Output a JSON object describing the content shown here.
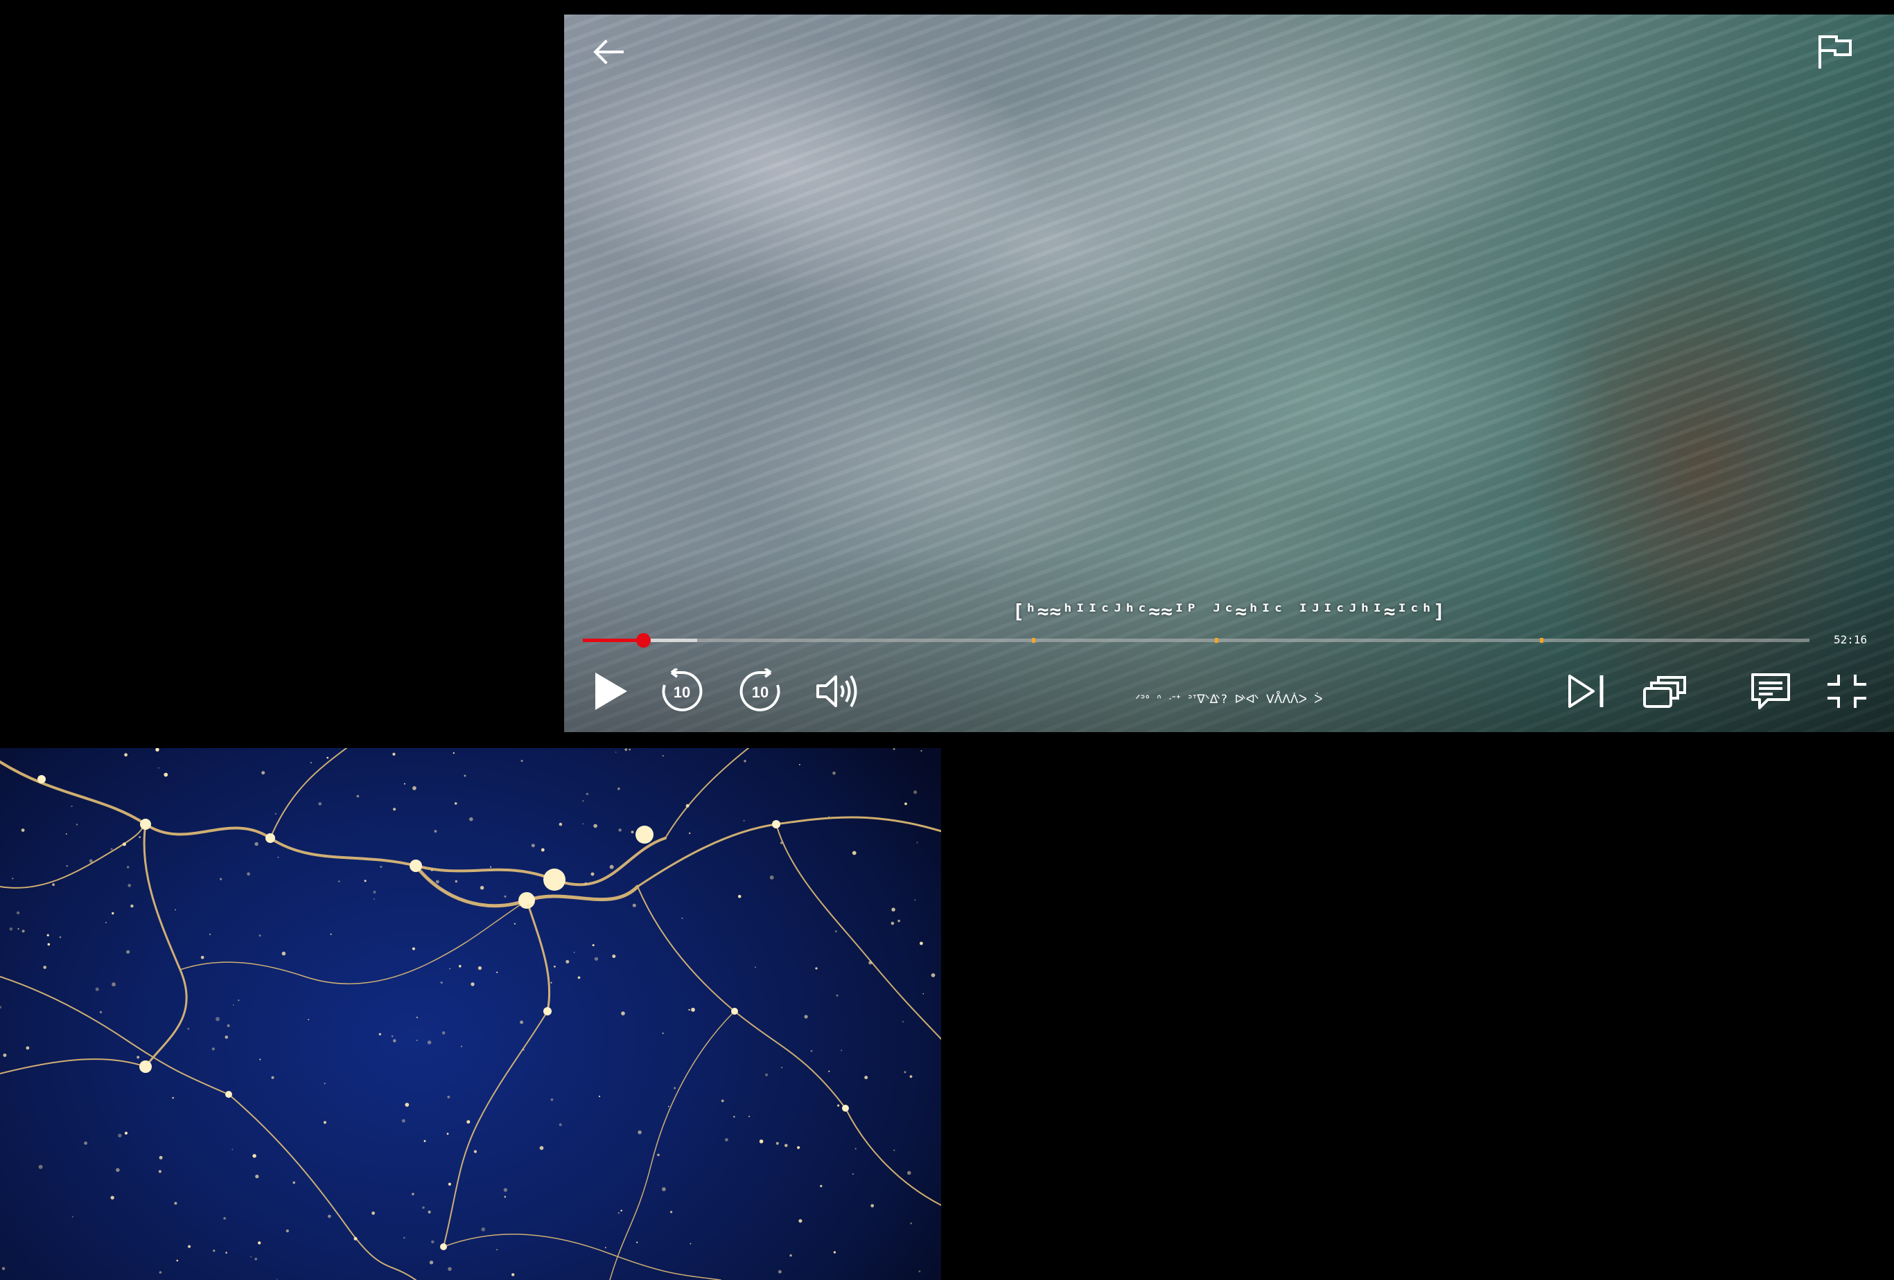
{
  "player": {
    "subtitle": "[ʰ≈≈ʰᴵᴵᶜᴶʰᶜ≈≈ᴵᴾ ᴶᶜ≈ʰᴵᶜ ᴵᴶᴵᶜᴶʰᴵ≈ᴵᶜʰ]",
    "time_remaining": "52:16",
    "episode_title": "ᐟᐣᐤ ᐢ ᐧᐨᐩ ᐣᐪᐫᐬ? ᐭᐮ ᐯᐰᐱᐲᐳ ᐴ",
    "progress": {
      "played_fraction": 0.049,
      "buffered_fraction": 0.093
    },
    "chapter_markers": [
      0.366,
      0.515,
      0.78
    ],
    "icons": {
      "back": "arrow-left-icon",
      "report": "flag-icon",
      "play": "play-icon",
      "rewind": "rewind-10-icon",
      "forward": "forward-10-icon",
      "volume": "volume-icon",
      "next": "next-episode-icon",
      "episodes": "episodes-icon",
      "subtitles": "subtitles-icon",
      "fullscreen": "exit-fullscreen-icon"
    },
    "skip_seconds": "10",
    "accent_color": "#e50914",
    "marker_color": "#f5a623"
  }
}
